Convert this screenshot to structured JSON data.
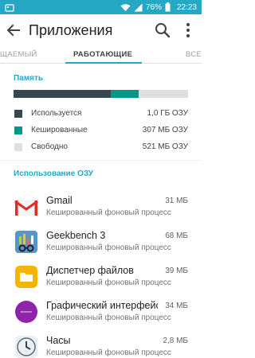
{
  "status_bar": {
    "battery": "76%",
    "time": "22:23",
    "accent_color": "#26a7c4"
  },
  "app_bar": {
    "title": "Приложения",
    "back_icon": "arrow-back-icon",
    "search_icon": "search-icon",
    "more_icon": "more-vert-icon"
  },
  "tabs": [
    {
      "label": "ЩАЕМЫЙ",
      "active": false
    },
    {
      "label": "РАБОТАЮЩИЕ",
      "active": true
    },
    {
      "label": "ВСЕ",
      "active": false
    }
  ],
  "memory": {
    "title": "Память",
    "bar": [
      {
        "key": "used",
        "fraction": 0.555,
        "color": "#37474f"
      },
      {
        "key": "cached",
        "fraction": 0.16,
        "color": "#009688"
      },
      {
        "key": "free",
        "fraction": 0.285,
        "color": "#e0e0e0"
      }
    ],
    "legend": [
      {
        "label": "Используется",
        "value": "1,0 ГБ ОЗУ",
        "color": "#37474f"
      },
      {
        "label": "Кешированные",
        "value": "307 МБ ОЗУ",
        "color": "#009688"
      },
      {
        "label": "Свободно",
        "value": "521 МБ ОЗУ",
        "color": "#e0e0e0"
      }
    ]
  },
  "ram_usage": {
    "title": "Использование ОЗУ",
    "apps": [
      {
        "name": "Gmail",
        "size": "31 МБ",
        "desc": "Кешированный фоновый процесс",
        "icon": "gmail-icon"
      },
      {
        "name": "Geekbench 3",
        "size": "68 МБ",
        "desc": "Кешированный фоновый процесс",
        "icon": "geekbench-icon"
      },
      {
        "name": "Диспетчер файлов",
        "size": "39 МБ",
        "desc": "Кешированный фоновый процесс",
        "icon": "file-manager-icon"
      },
      {
        "name": "Графический интерфейс с",
        "size": "34 МБ",
        "desc": "Кешированный фоновый процесс",
        "icon": "lollipop-icon"
      },
      {
        "name": "Часы",
        "size": "2,8 МБ",
        "desc": "Кешированный фоновый процесс",
        "icon": "clock-icon"
      }
    ]
  }
}
